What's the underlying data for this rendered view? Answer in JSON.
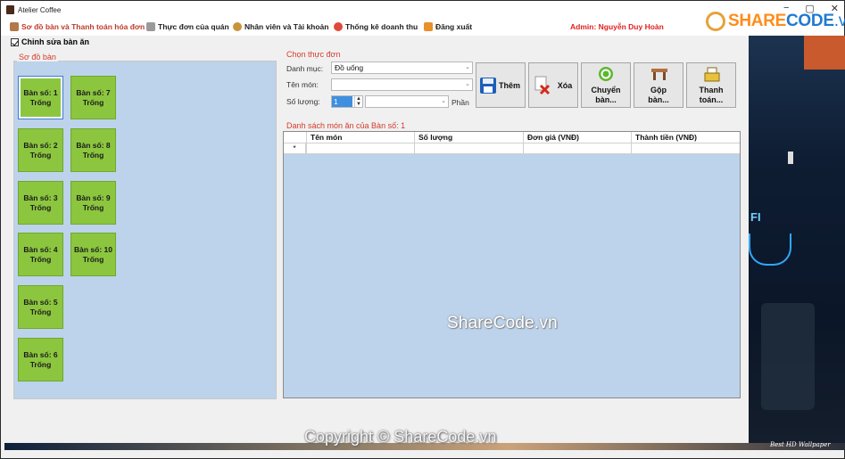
{
  "window": {
    "title": "Atelier Coffee",
    "controls": [
      "−",
      "▢",
      "✕"
    ]
  },
  "menubar": {
    "items": [
      {
        "label": "Sơ đồ bàn và Thanh toán hóa đơn",
        "icon": "coffee-cup-icon"
      },
      {
        "label": "Thực đơn của quán",
        "icon": "menu-book-icon"
      },
      {
        "label": "Nhân viên và Tài khoản",
        "icon": "employee-icon"
      },
      {
        "label": "Thống kê doanh thu",
        "icon": "statistics-icon"
      },
      {
        "label": "Đăng xuất",
        "icon": "logout-icon"
      }
    ],
    "admin": "Admin: Nguyễn Duy Hoàn"
  },
  "logo": {
    "part1": "SHARE",
    "part2": "CODE",
    "part3": ".vn"
  },
  "edit_check": {
    "label": "Chỉnh sửa bàn ăn",
    "checked": true
  },
  "table_map": {
    "title": "Sơ đồ bàn",
    "tables": [
      {
        "name": "Bàn số: 1",
        "status": "Trống"
      },
      {
        "name": "Bàn số: 2",
        "status": "Trống"
      },
      {
        "name": "Bàn số: 3",
        "status": "Trống"
      },
      {
        "name": "Bàn số: 4",
        "status": "Trống"
      },
      {
        "name": "Bàn số: 5",
        "status": "Trống"
      },
      {
        "name": "Bàn số: 6",
        "status": "Trống"
      },
      {
        "name": "Bàn số: 7",
        "status": "Trống"
      },
      {
        "name": "Bàn số: 8",
        "status": "Trống"
      },
      {
        "name": "Bàn số: 9",
        "status": "Trống"
      },
      {
        "name": "Bàn số: 10",
        "status": "Trống"
      }
    ]
  },
  "menu_select": {
    "title": "Chọn thực đơn",
    "category_label": "Danh mục:",
    "category_value": "Đồ uống",
    "item_label": "Tên món:",
    "item_value": "",
    "quantity_label": "Số lượng:",
    "quantity_value": "1",
    "unit_label": "Phần",
    "buttons": {
      "add": "Thêm",
      "delete": "Xóa",
      "move_line1": "Chuyển",
      "move_line2": "bàn...",
      "merge_line1": "Gộp",
      "merge_line2": "bàn...",
      "pay_line1": "Thanh",
      "pay_line2": "toán..."
    }
  },
  "order_list": {
    "title": "Danh sách món ăn của Bàn số: 1",
    "columns": [
      "Tên món",
      "Số lượng",
      "Đơn giá (VNĐ)",
      "Thành tiền (VNĐ)"
    ],
    "new_row_marker": "*"
  },
  "watermarks": {
    "center": "ShareCode.vn",
    "copyright": "Copyright © ShareCode.vn",
    "wallpaper_credit": "Best HD Wallpaper",
    "wall_sign": "FI"
  },
  "colors": {
    "table_free": "#8cc63f",
    "group_title": "#d63a2c",
    "panel_bg": "#bcd3eb"
  }
}
